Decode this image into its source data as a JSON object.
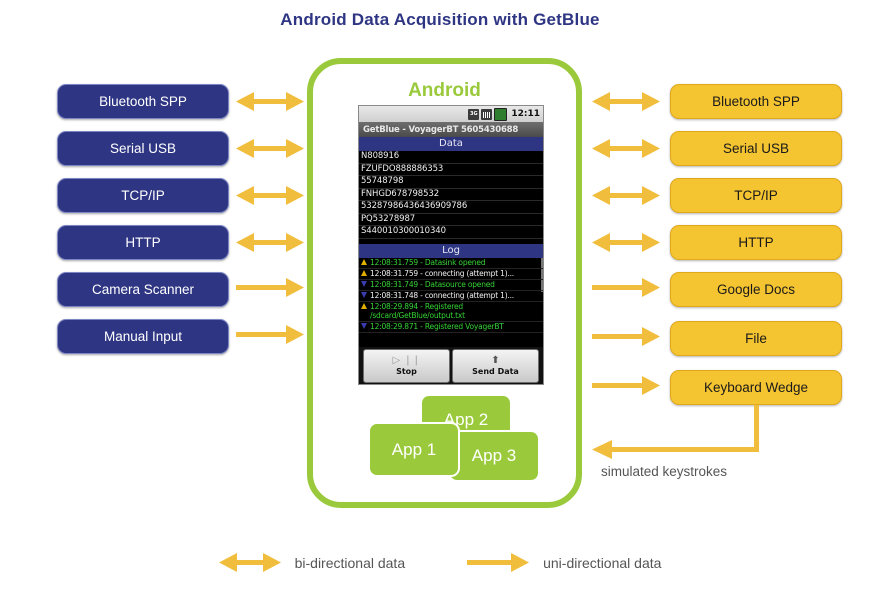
{
  "page": {
    "title": "Android Data Acquisition with GetBlue"
  },
  "colors": {
    "title_blue": "#2E3583",
    "box_blue": "#2E3583",
    "box_orange": "#F5C431",
    "android_green": "#9ACA3C",
    "arrow_gold": "#F0BE3C",
    "legend_gray": "#555555"
  },
  "left_column": {
    "items": [
      {
        "label": "Bluetooth SPP",
        "arrow": "bi-directional"
      },
      {
        "label": "Serial USB",
        "arrow": "bi-directional"
      },
      {
        "label": "TCP/IP",
        "arrow": "bi-directional"
      },
      {
        "label": "HTTP",
        "arrow": "bi-directional"
      },
      {
        "label": "Camera Scanner",
        "arrow": "uni-directional"
      },
      {
        "label": "Manual Input",
        "arrow": "uni-directional"
      }
    ]
  },
  "right_column": {
    "items": [
      {
        "label": "Bluetooth SPP",
        "arrow": "bi-directional"
      },
      {
        "label": "Serial USB",
        "arrow": "bi-directional"
      },
      {
        "label": "TCP/IP",
        "arrow": "bi-directional"
      },
      {
        "label": "HTTP",
        "arrow": "bi-directional"
      },
      {
        "label": "Google Docs",
        "arrow": "uni-directional"
      },
      {
        "label": "File",
        "arrow": "uni-directional"
      },
      {
        "label": "Keyboard Wedge",
        "arrow": "uni-directional"
      }
    ]
  },
  "android": {
    "label": "Android",
    "status_bar": {
      "time": "12:11",
      "icons": [
        "3g-icon",
        "signal-icon",
        "battery-icon"
      ],
      "network_badge": "3G"
    },
    "app_titlebar": "GetBlue - VoyagerBT 5605430688",
    "data_section": {
      "header": "Data",
      "rows": [
        "N808916",
        "FZUFDO888886353",
        "55748798",
        "FNHGD678798532",
        "53287986436436909786",
        "PQ53278987",
        "S440010300010340"
      ]
    },
    "log_section": {
      "header": "Log",
      "entries": [
        {
          "text": "12:08:31.759 - Datasink opened",
          "color": "green",
          "marker": "up-yellow"
        },
        {
          "text": "12:08:31.759 - connecting (attempt 1)...",
          "color": "white",
          "marker": "up-yellow"
        },
        {
          "text": "12:08:31.749 - Datasource opened",
          "color": "green",
          "marker": "down-blue"
        },
        {
          "text": "12:08:31.748 - connecting (attempt 1)...",
          "color": "white",
          "marker": "down-blue"
        },
        {
          "text": "12:08:29.894 - Registered /sdcard/GetBlue/output.txt",
          "color": "green",
          "marker": "up-yellow"
        },
        {
          "text": "12:08:29.871 - Registered VoyagerBT",
          "color": "green",
          "marker": "down-blue"
        }
      ]
    },
    "buttons": [
      {
        "label": "Stop",
        "glyph": "▷ ❘❘",
        "icon": "play-pause-icon"
      },
      {
        "label": "Send Data",
        "glyph": "⬆",
        "icon": "upload-icon"
      }
    ],
    "apps": [
      {
        "label": "App 1"
      },
      {
        "label": "App 2"
      },
      {
        "label": "App 3"
      }
    ]
  },
  "annotations": {
    "simulated_keystrokes": "simulated keystrokes"
  },
  "legend": {
    "items": [
      {
        "label": "bi-directional data",
        "arrow": "bi-directional"
      },
      {
        "label": "uni-directional data",
        "arrow": "uni-directional"
      }
    ]
  }
}
